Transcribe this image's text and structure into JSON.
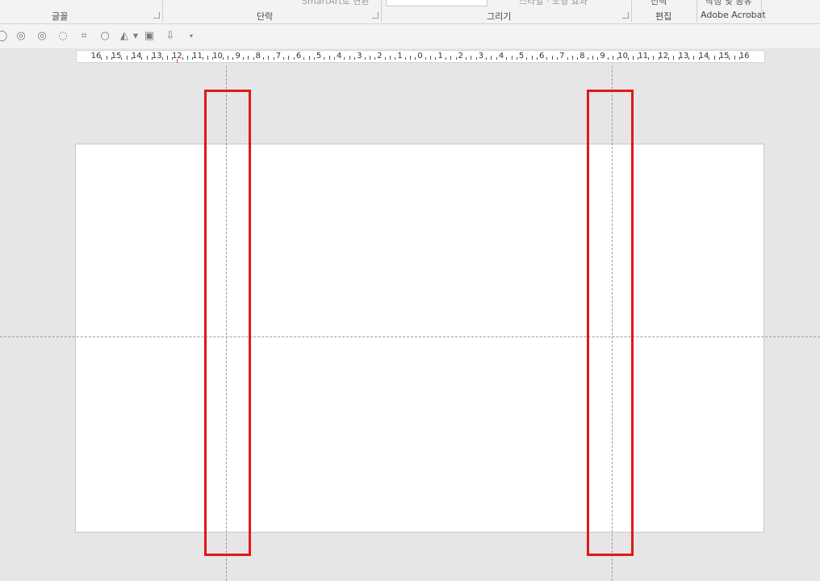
{
  "ribbon": {
    "groups": [
      {
        "label": "글꼴"
      },
      {
        "label": "단락"
      },
      {
        "label": "그리기"
      },
      {
        "label": "편집"
      },
      {
        "label": "Adobe Acrobat"
      }
    ],
    "cut_texts": {
      "smartart": "SmartArt로 변환",
      "styles": "스타일 · 도형 효과",
      "select": "선택",
      "create_share": "작성 및 공유"
    }
  },
  "qat": {
    "icons": [
      "ellipse-icon",
      "union-icon",
      "combine-icon",
      "fragment-icon",
      "crop-icon",
      "circle-icon",
      "shape-fill-icon",
      "dropdown-icon",
      "picture-icon",
      "arrange-icon",
      "more-icon"
    ]
  },
  "ruler": {
    "labels": [
      "16",
      "15",
      "14",
      "13",
      "12",
      "11",
      "10",
      "9",
      "8",
      "7",
      "6",
      "5",
      "4",
      "3",
      "2",
      "1",
      "0",
      "1",
      "2",
      "3",
      "4",
      "5",
      "6",
      "7",
      "8",
      "9",
      "10",
      "11",
      "12",
      "13",
      "14",
      "15",
      "16"
    ]
  },
  "colors": {
    "highlight": "#e01818",
    "workspace": "#e6e6e6",
    "slide": "#ffffff",
    "guide": "#9c9c9c"
  }
}
